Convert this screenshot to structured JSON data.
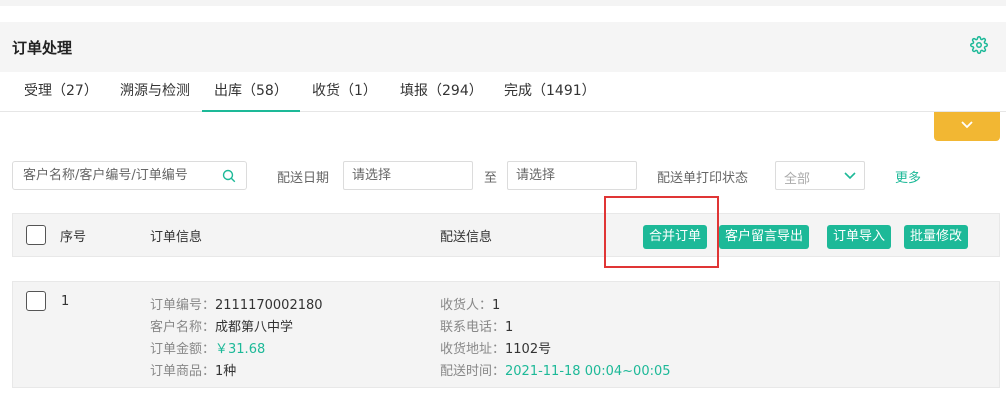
{
  "page": {
    "title": "订单处理"
  },
  "tabs": [
    {
      "label": "受理（27）"
    },
    {
      "label": "溯源与检测"
    },
    {
      "label": "出库（58）"
    },
    {
      "label": "收货（1）"
    },
    {
      "label": "填报（294）"
    },
    {
      "label": "完成（1491）"
    }
  ],
  "active_tab_index": 2,
  "filters": {
    "search_placeholder": "客户名称/客户编号/订单编号",
    "date_label": "配送日期",
    "date_start_placeholder": "请选择",
    "date_sep": "至",
    "date_end_placeholder": "请选择",
    "print_status_label": "配送单打印状态",
    "print_status_value": "全部",
    "more": "更多"
  },
  "table": {
    "headers": {
      "index": "序号",
      "order_info": "订单信息",
      "delivery_info": "配送信息"
    },
    "actions": [
      "合并订单",
      "客户留言导出",
      "订单导入",
      "批量修改"
    ],
    "rows": [
      {
        "index": "1",
        "order_no_label": "订单编号：",
        "order_no": "2111170002180",
        "customer_label": "客户名称：",
        "customer": "成都第八中学",
        "amount_label": "订单金额：",
        "amount": "￥31.68",
        "goods_label": "订单商品：",
        "goods": "1种",
        "receiver_label": "收货人：",
        "receiver": "1",
        "phone_label": "联系电话：",
        "phone": "1",
        "address_label": "收货地址：",
        "address": "1102号",
        "time_label": "配送时间：",
        "time": "2021-11-18 00:04~00:05"
      }
    ]
  },
  "colors": {
    "accent": "#1db998",
    "expand": "#f2b733",
    "highlight": "#e03535"
  },
  "icons": {
    "settings": "gear-icon",
    "search": "search-icon",
    "expand": "chevron-down-icon",
    "select": "chevron-down-icon"
  }
}
